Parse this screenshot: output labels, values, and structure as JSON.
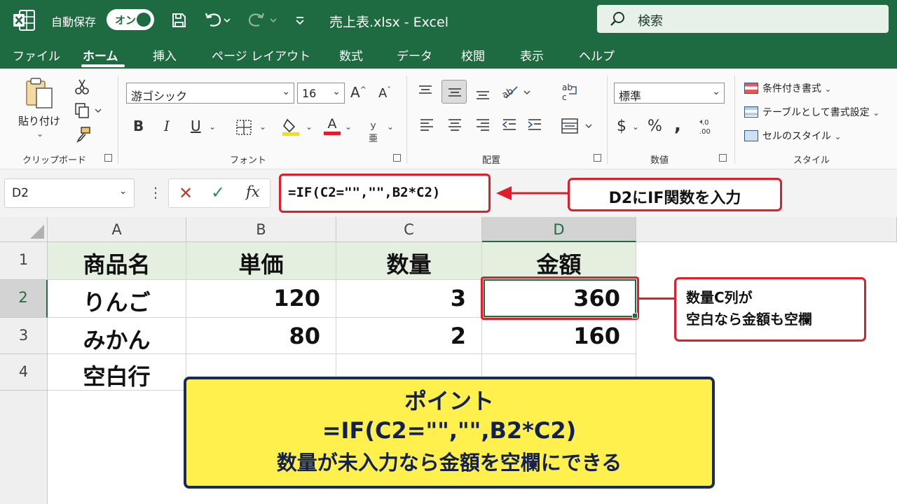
{
  "titlebar": {
    "autosave_label": "自動保存",
    "autosave_state": "オン",
    "document_title": "売上表.xlsx  -  Excel",
    "search_placeholder": "検索",
    "accent_color": "#1e6b41"
  },
  "tabs": [
    "ファイル",
    "ホーム",
    "挿入",
    "ページ レイアウト",
    "数式",
    "データ",
    "校閲",
    "表示",
    "ヘルプ"
  ],
  "active_tab": "ホーム",
  "ribbon": {
    "clipboard": {
      "paste_label": "貼り付け",
      "group_label": "クリップボード"
    },
    "font": {
      "font_name": "游ゴシック",
      "font_size": "16",
      "group_label": "フォント"
    },
    "alignment": {
      "group_label": "配置"
    },
    "number": {
      "format": "標準",
      "group_label": "数値"
    },
    "styles": {
      "conditional": "条件付き書式",
      "table": "テーブルとして書式設定",
      "cell_styles": "セルのスタイル",
      "group_label": "スタイル"
    }
  },
  "formula_bar": {
    "name_box": "D2",
    "formula": "=IF(C2=\"\",\"\",B2*C2)",
    "callout": "D2にIF関数を入力"
  },
  "sheet": {
    "columns": [
      "A",
      "B",
      "C",
      "D"
    ],
    "rows": [
      "1",
      "2",
      "3",
      "4"
    ],
    "header": [
      "商品名",
      "単価",
      "数量",
      "金額"
    ],
    "data": [
      [
        "りんご",
        "120",
        "3",
        "360"
      ],
      [
        "みかん",
        "80",
        "2",
        "160"
      ],
      [
        "空白行",
        "",
        "",
        ""
      ]
    ],
    "selected_cell": "D2"
  },
  "annotations": {
    "blank_note": [
      "数量C列が",
      "空白なら金額も空欄"
    ],
    "point_title": "ポイント",
    "point_formula": "=IF(C2=\"\",\"\",B2*C2)",
    "point_text": "数量が未入力なら金額を空欄にできる",
    "highlight_color": "#e11d2b",
    "point_bg": "#fff04d"
  }
}
